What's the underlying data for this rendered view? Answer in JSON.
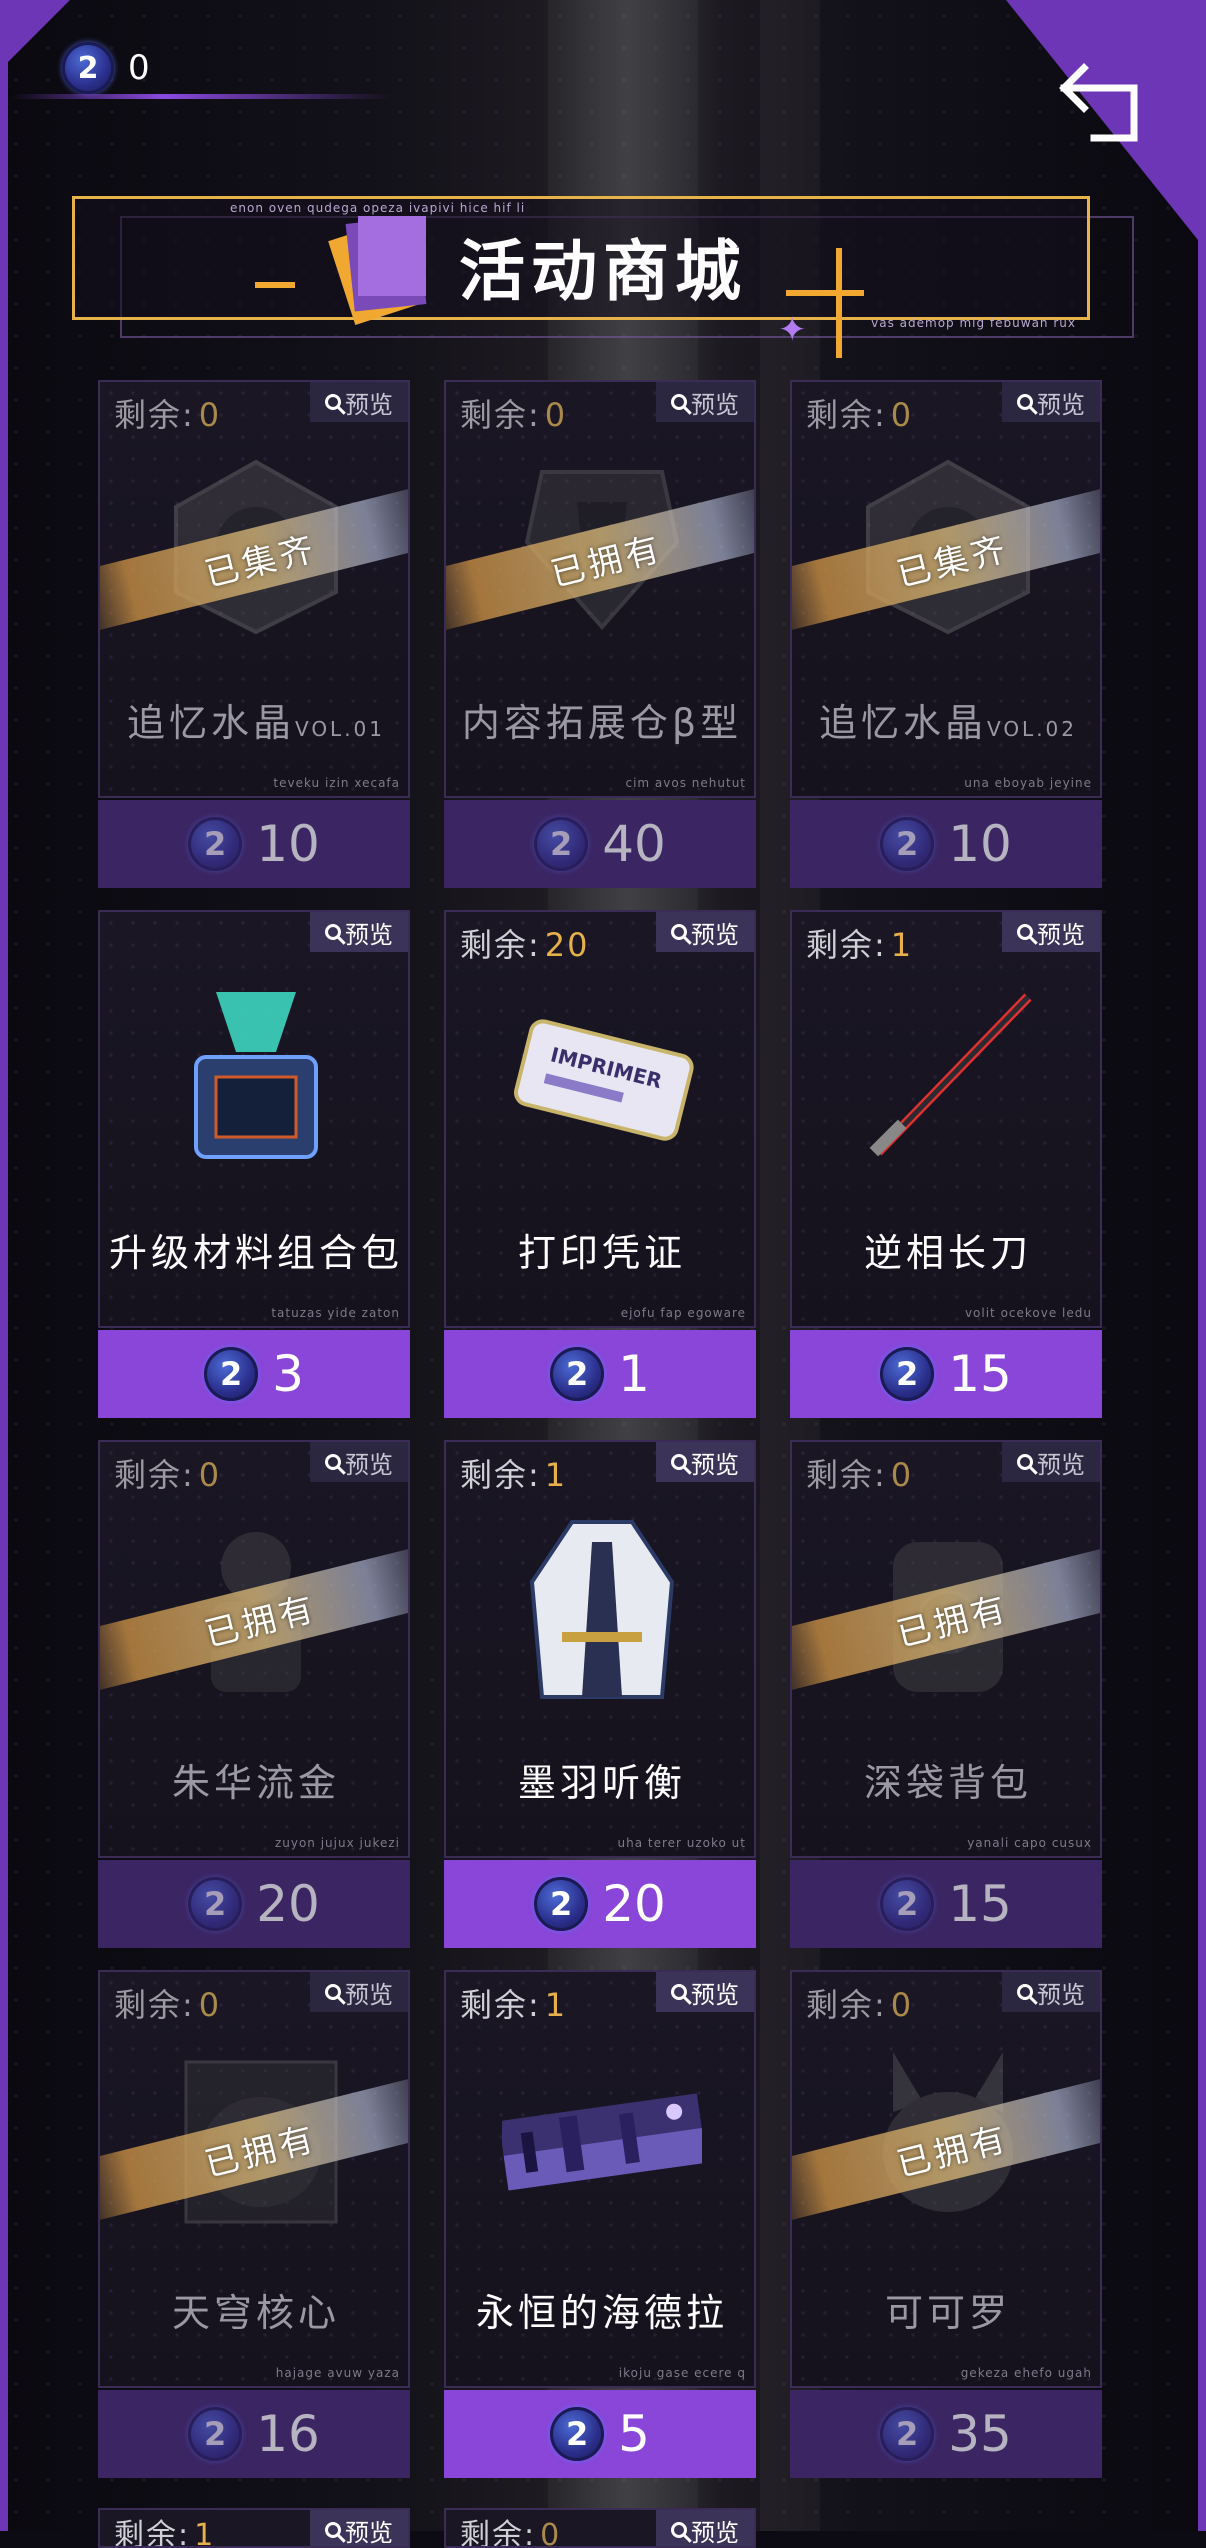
{
  "header": {
    "currency_count": "0",
    "currency_icon": "coin-icon",
    "title": "活动商城",
    "sub_top": "enon oven qudega opeza ivapivi hice hif li",
    "sub_bottom": "vas ademop mig febuwah rux",
    "back_icon": "back-arrow-icon"
  },
  "labels": {
    "remaining": "剩余:",
    "preview": "预览",
    "coin_glyph": "2"
  },
  "colors": {
    "accent_purple": "#8a46d8",
    "accent_gold": "#e6b04a",
    "frame_purple": "#6d36b6"
  },
  "items": [
    {
      "remaining": "0",
      "name": "追忆水晶",
      "name_small": "VOL.01",
      "status": "已集齐",
      "caption": "teveku izin xecafa",
      "price": "10",
      "dim": true,
      "art": "crystal"
    },
    {
      "remaining": "0",
      "name": "内容拓展仓β型",
      "name_small": "",
      "status": "已拥有",
      "caption": "cim avos nehutut",
      "price": "40",
      "dim": true,
      "art": "shield"
    },
    {
      "remaining": "0",
      "name": "追忆水晶",
      "name_small": "VOL.02",
      "status": "已集齐",
      "caption": "una eboyab jeyine",
      "price": "10",
      "dim": true,
      "art": "crystal"
    },
    {
      "remaining": "",
      "name": "升级材料组合包",
      "name_small": "",
      "status": "",
      "caption": "tatuzas yide zaton",
      "price": "3",
      "dim": false,
      "art": "box"
    },
    {
      "remaining": "20",
      "name": "打印凭证",
      "name_small": "",
      "status": "",
      "caption": "ejofu fap egoware",
      "price": "1",
      "dim": false,
      "art": "ticket",
      "ticket_text": "IMPRIMER"
    },
    {
      "remaining": "1",
      "name": "逆相长刀",
      "name_small": "",
      "status": "",
      "caption": "volit ocekove ledu",
      "price": "15",
      "dim": false,
      "art": "blade"
    },
    {
      "remaining": "0",
      "name": "朱华流金",
      "name_small": "",
      "status": "已拥有",
      "caption": "zuyon jujux jukezi",
      "price": "20",
      "dim": true,
      "art": "figure"
    },
    {
      "remaining": "1",
      "name": "墨羽听衡",
      "name_small": "",
      "status": "",
      "caption": "uha terer uzoko ut",
      "price": "20",
      "dim": false,
      "art": "coat"
    },
    {
      "remaining": "0",
      "name": "深袋背包",
      "name_small": "",
      "status": "已拥有",
      "caption": "yanali capo cusux",
      "price": "15",
      "dim": true,
      "art": "backpack"
    },
    {
      "remaining": "0",
      "name": "天穹核心",
      "name_small": "",
      "status": "已拥有",
      "caption": "hajage avuw yaza",
      "price": "16",
      "dim": true,
      "art": "core"
    },
    {
      "remaining": "1",
      "name": "永恒的海德拉",
      "name_small": "",
      "status": "",
      "caption": "ikoju gase ecere q",
      "price": "5",
      "dim": false,
      "art": "poster"
    },
    {
      "remaining": "0",
      "name": "可可罗",
      "name_small": "",
      "status": "已拥有",
      "caption": "gekeza ehefo ugah",
      "price": "35",
      "dim": true,
      "art": "mascot"
    }
  ],
  "partial_row": [
    {
      "remaining": "1"
    },
    {
      "remaining": "0"
    }
  ]
}
